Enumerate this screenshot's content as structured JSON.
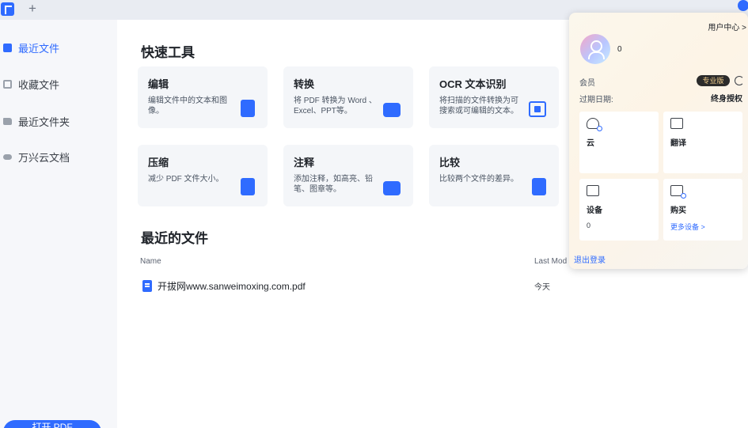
{
  "topbar": {
    "new_tab_label": "+"
  },
  "sidebar": {
    "items": [
      {
        "label": "最近文件",
        "active": true,
        "icon": "document-icon"
      },
      {
        "label": "收藏文件",
        "active": false,
        "icon": "star-icon"
      },
      {
        "label": "最近文件夹",
        "active": false,
        "icon": "folder-icon"
      },
      {
        "label": "万兴云文档",
        "active": false,
        "icon": "cloud-icon"
      }
    ],
    "open_button_label": "打开 PDF"
  },
  "main": {
    "quick_tools_title": "快速工具",
    "tools": [
      {
        "title": "编辑",
        "desc": "编辑文件中的文本和图像。"
      },
      {
        "title": "转换",
        "desc": "将 PDF 转换为 Word 、Excel、PPT等。"
      },
      {
        "title": "OCR 文本识别",
        "desc": "将扫描的文件转换为可搜索或可编辑的文本。"
      },
      {
        "title": "压缩",
        "desc": "减少 PDF 文件大小。"
      },
      {
        "title": "注释",
        "desc": "添加注释，如高亮、铅笔、图章等。"
      },
      {
        "title": "比较",
        "desc": "比较两个文件的差异。"
      }
    ],
    "recent_title": "最近的文件",
    "columns": {
      "name": "Name",
      "last_modified": "Last Mod"
    },
    "files": [
      {
        "name": "开拔网www.sanweimoxing.com.pdf",
        "date": "今天"
      }
    ]
  },
  "popover": {
    "user_center_link": "用户中心 >",
    "user_name": "0",
    "member_label": "会员",
    "badge": "专业版",
    "expiry_label": "过期日期:",
    "expiry_value": "终身授权",
    "tiles": {
      "cloud": {
        "title": "云"
      },
      "translate": {
        "title": "翻译"
      },
      "devices": {
        "title": "设备",
        "count": "0"
      },
      "purchase": {
        "title": "购买",
        "link": "更多设备 >"
      }
    },
    "logout_label": "退出登录"
  },
  "colors": {
    "accent": "#2f6bff",
    "badge_bg": "#2b2b2b",
    "badge_text": "#f3cf8c"
  }
}
